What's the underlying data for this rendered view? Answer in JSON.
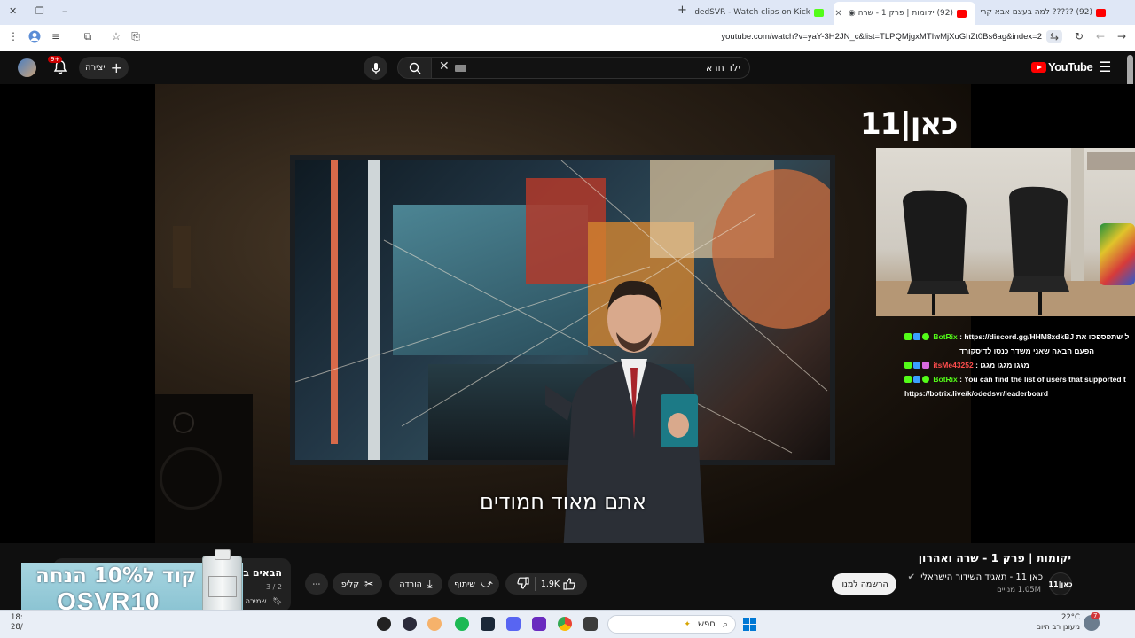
{
  "browser": {
    "tabs": [
      {
        "title": "(92) ????? למה בעצם אבא קרי",
        "favicon_color": "#ff0000"
      },
      {
        "title": "(92) יקומות | פרק 1 - שרה",
        "favicon_color": "#ff0000",
        "active": true
      },
      {
        "title": "OdedSVR - Watch clips on Kick",
        "favicon_color": "#53fc18"
      }
    ],
    "new_tab": "+",
    "url": "youtube.com/watch?v=yaY-3H2JN_c&list=TLPQMjgxMTIwMjXuGhZt0Bs6ag&index=2"
  },
  "youtube": {
    "logo_text": "YouTube",
    "search_query": "ילד חרא",
    "create_label": "יצירה",
    "notification_badge": "9+"
  },
  "video": {
    "channel_watermark": "כאן|11",
    "subtitle": "אתם מאוד חמודים",
    "title": "יקומות | פרק 1 - שרה ואהרון",
    "channel_name": "כאן 11 - תאגיד השידור הישראלי",
    "channel_avatar_text": "כאן|11",
    "subscribers": "1.05M מנויים",
    "subscribe_label": "הרשמה למנוי",
    "likes": "1.9K",
    "share_label": "שיתוף",
    "download_label": "הורדה",
    "clip_label": "קליפ",
    "more": "⋯"
  },
  "chat": [
    {
      "name": "BotRix",
      "name_color": "#53fc18",
      "text": ": https://discord.gg/HHM8xdkBJ ל שתפספסו את",
      "line2": "הפעם הבאה שאני משדר כנסו לדיסקורד"
    },
    {
      "name": "itsMe43252",
      "name_color": "#ff4d4d",
      "text": ": מגגו מגגו מגגו"
    },
    {
      "name": "BotRix",
      "name_color": "#53fc18",
      "text": ": You can find the list of users that supported t",
      "line2": "https://botrix.live/k/odedsvr/leaderboard"
    }
  ],
  "playlist": {
    "title": "הבאים ב",
    "count": "3 / 2",
    "save_label": "שמירה"
  },
  "ad": {
    "line1": "קוד ל10% הנחה",
    "line2": "OSVR10"
  },
  "taskbar": {
    "search_placeholder": "חפש",
    "weather_temp": "22°C",
    "weather_desc": "מעונן רב היום",
    "weather_badge": "7",
    "clock_time": "18:",
    "clock_date": "28/"
  }
}
